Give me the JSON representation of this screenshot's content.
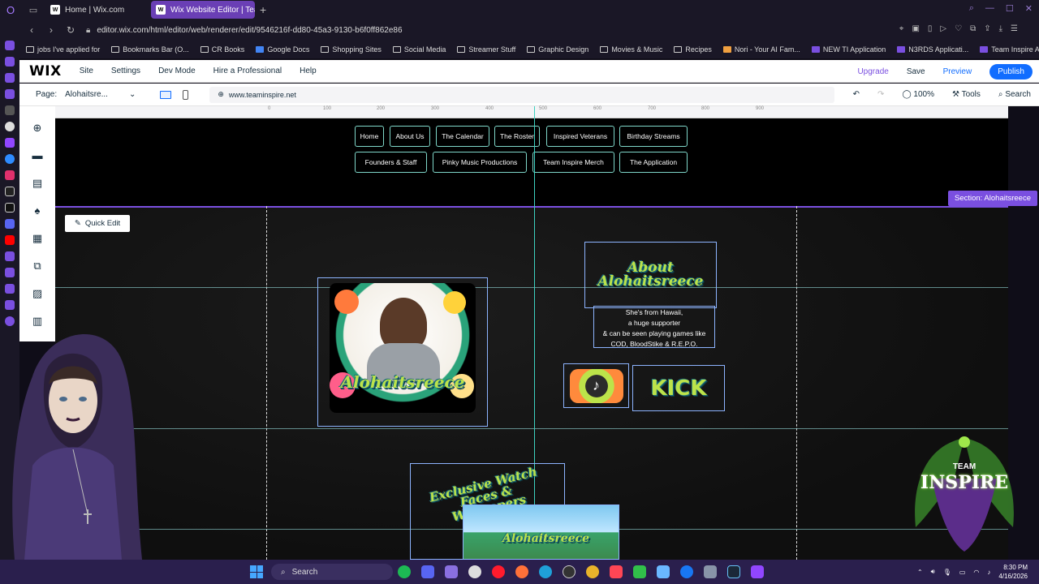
{
  "browser": {
    "tabs": [
      {
        "label": "Home | Wix.com",
        "active": false
      },
      {
        "label": "Wix Website Editor | Team",
        "active": true
      }
    ],
    "url": "editor.wix.com/html/editor/web/renderer/edit/9546216f-dd80-45a3-9130-b6f0ff862e86",
    "bookmarks": [
      "jobs I've applied for",
      "Bookmarks Bar (O...",
      "CR Books",
      "Google Docs",
      "Shopping Sites",
      "Social Media",
      "Streamer Stuff",
      "Graphic Design",
      "Movies & Music",
      "Recipes",
      "Nori - Your AI Fam...",
      "NEW TI Application",
      "N3RDS Applicati...",
      "Team Inspire Appli..."
    ]
  },
  "wix": {
    "logo": "WIX",
    "menu": [
      "Site",
      "Settings",
      "Dev Mode",
      "Hire a Professional",
      "Help"
    ],
    "upgrade": "Upgrade",
    "save": "Save",
    "preview": "Preview",
    "publish": "Publish",
    "page_label": "Page:",
    "page_value": "Alohaitsre...",
    "domain": "www.teaminspire.net",
    "zoom": "100%",
    "tools": "Tools",
    "search": "Search"
  },
  "canvas": {
    "ruler_ticks": [
      "0",
      "100",
      "200",
      "300",
      "400",
      "500",
      "600",
      "700",
      "800",
      "900"
    ],
    "nav_row1": [
      "Home",
      "About Us",
      "The Calendar",
      "The Roster",
      "Inspired Veterans",
      "Birthday Streams"
    ],
    "nav_row2": [
      "Founders & Staff",
      "Pinky Music Productions",
      "Team Inspire Merch",
      "The Application"
    ],
    "section_tag": "Section: Alohaitsreece",
    "quick_edit": "Quick Edit",
    "hero_name": "Alohaitsreece",
    "about_title": "About Alohaitsreece",
    "about_lines": [
      "She's from Hawaii,",
      "a huge supporter",
      "& can be seen playing games like",
      "COD, BloodStike & R.E.P.O."
    ],
    "kick_label": "KICK",
    "watch_title": "Exclusive Watch Faces & Wallpapers",
    "watch_name": "Alohaitsreece",
    "team_logo_line1": "TEAM",
    "team_logo_line2": "INSPIRE"
  },
  "taskbar": {
    "search": "Search",
    "time": "8:30 PM",
    "date": "4/16/2026"
  },
  "colors": {
    "accent": "#7a4fe0",
    "wix_blue": "#116dff",
    "nav_border": "#7fd7c9",
    "guide_teal": "#3dd1c0",
    "taskbar": "#2a1f4d"
  }
}
